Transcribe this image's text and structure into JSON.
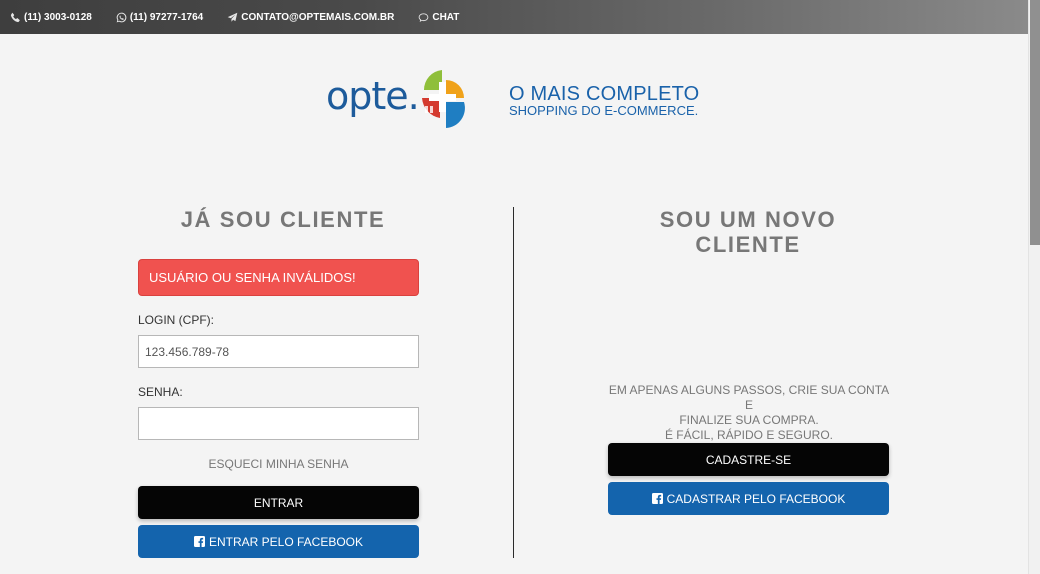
{
  "topbar": {
    "phone": "(11) 3003-0128",
    "whatsapp": "(11) 97277-1764",
    "email": "CONTATO@OPTEMAIS.COM.BR",
    "chat": "CHAT"
  },
  "header": {
    "logo_text": "opte.",
    "tagline_main": "O MAIS COMPLETO",
    "tagline_sub": "SHOPPING DO E-COMMERCE."
  },
  "login": {
    "title": "JÁ SOU CLIENTE",
    "error_message": "USUÁRIO OU SENHA INVÁLIDOS!",
    "login_label": "LOGIN (CPF):",
    "login_value": "123.456.789-78",
    "password_label": "SENHA:",
    "password_value": "",
    "forgot_link": "ESQUECI MINHA SENHA",
    "submit_label": "ENTRAR",
    "facebook_label": "ENTRAR PELO FACEBOOK"
  },
  "register": {
    "title_line1": "SOU UM NOVO",
    "title_line2": "CLIENTE",
    "desc_line1": "EM APENAS ALGUNS PASSOS, CRIE SUA CONTA E",
    "desc_line2": "FINALIZE SUA COMPRA.",
    "desc_line3": "É FÁCIL, RÁPIDO E SEGURO.",
    "signup_label": "CADASTRE-SE",
    "facebook_label": "CADASTRAR PELO FACEBOOK"
  },
  "colors": {
    "topbar": "#4a4a4a",
    "brand_blue": "#1d5b9b",
    "error_red": "#f0524f",
    "facebook_blue": "#1464ad",
    "button_black": "#050505"
  }
}
